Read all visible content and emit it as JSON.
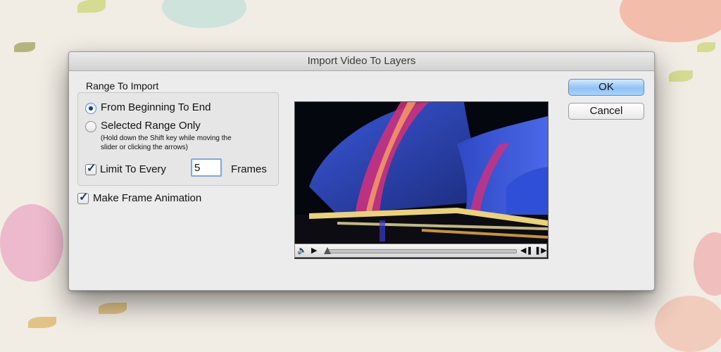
{
  "dialog": {
    "title": "Import Video To Layers",
    "range_group": {
      "label": "Range To Import",
      "option_all": "From Beginning To End",
      "option_selected": "Selected Range Only",
      "hint": "(Hold down the Shift key while moving the slider or clicking the arrows)",
      "hint_line1": "(Hold down the Shift key while moving the",
      "hint_line2": "slider or clicking the arrows)",
      "selected_option": "From Beginning To End",
      "limit_label": "Limit To Every",
      "limit_checked": true,
      "limit_value": "5",
      "frames_label": "Frames"
    },
    "make_animation_label": "Make Frame Animation",
    "make_animation_checked": true,
    "buttons": {
      "ok": "OK",
      "cancel": "Cancel"
    },
    "preview": {
      "icons": [
        "speaker-icon",
        "play-icon",
        "step-back-icon",
        "step-forward-icon"
      ],
      "playhead_position": 0
    }
  },
  "colors": {
    "ok_button": "#8fc3f5",
    "dialog_bg": "#ececec",
    "accent": "#1e3d73"
  }
}
